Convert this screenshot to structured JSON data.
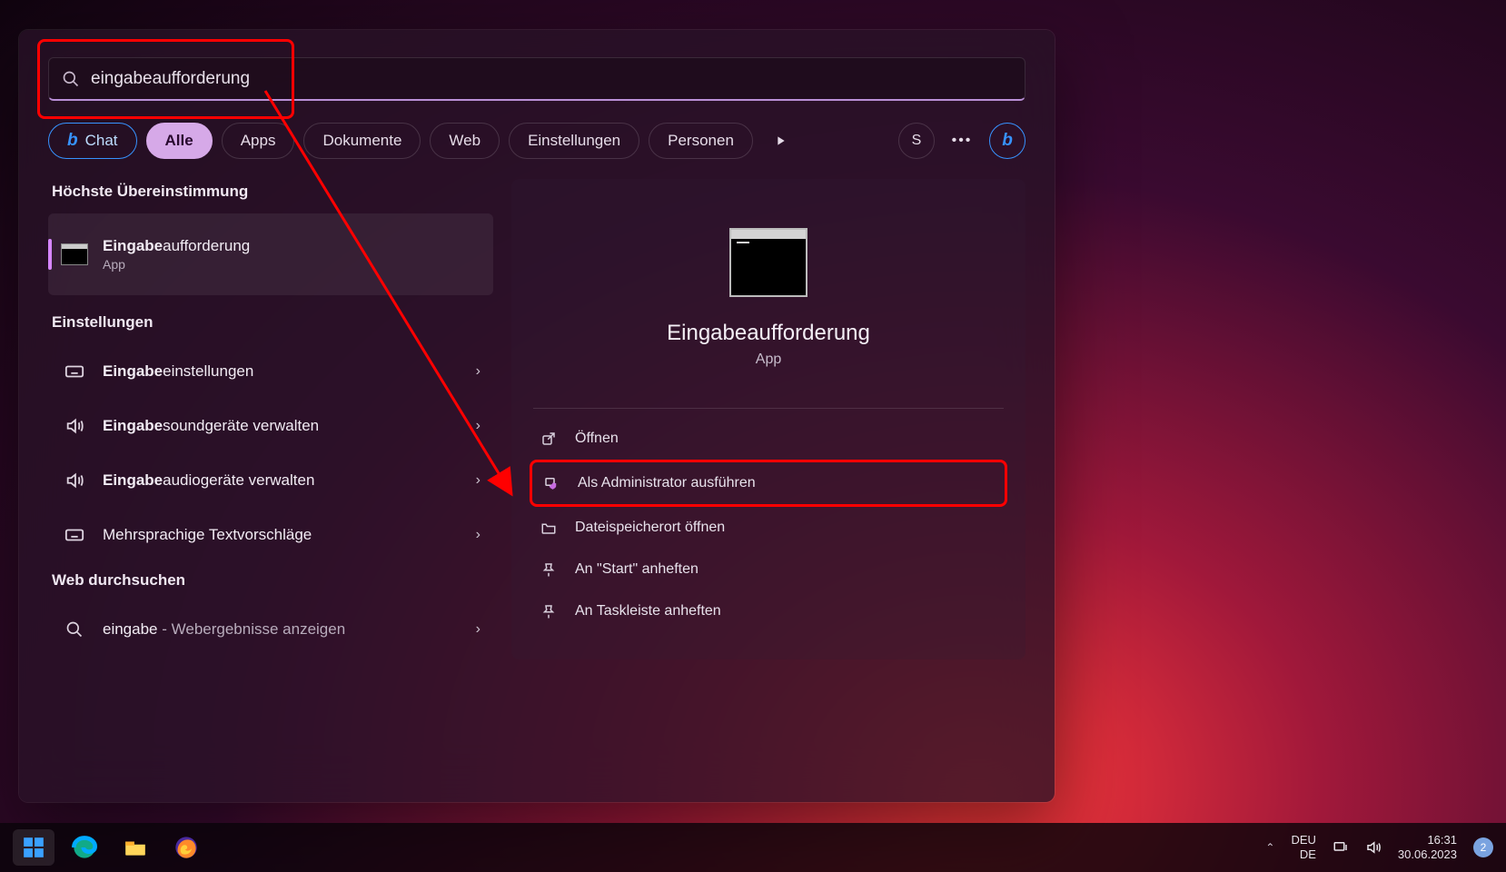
{
  "search": {
    "prefix": "eingabe",
    "suffix": "aufforderung"
  },
  "filters": {
    "chat": "Chat",
    "all": "Alle",
    "apps": "Apps",
    "documents": "Dokumente",
    "web": "Web",
    "settings": "Einstellungen",
    "people": "Personen",
    "avatar_initial": "S"
  },
  "left": {
    "best_match_header": "Höchste Übereinstimmung",
    "best": {
      "bold": "Eingabe",
      "rest": "aufforderung",
      "sub": "App"
    },
    "settings_header": "Einstellungen",
    "settings_items": [
      {
        "bold": "Eingabe",
        "rest": "einstellungen",
        "icon": "keyboard"
      },
      {
        "bold": "Eingabe",
        "rest": "soundgeräte verwalten",
        "icon": "sound"
      },
      {
        "bold": "Eingabe",
        "rest": "audiogeräte verwalten",
        "icon": "sound"
      },
      {
        "bold": "",
        "rest": "Mehrsprachige Textvorschläge",
        "icon": "keyboard"
      }
    ],
    "web_header": "Web durchsuchen",
    "web_item": {
      "query": "eingabe",
      "suffix": " - Webergebnisse anzeigen"
    }
  },
  "right": {
    "title": "Eingabeaufforderung",
    "sub": "App",
    "actions": {
      "open": "Öffnen",
      "admin": "Als Administrator ausführen",
      "location": "Dateispeicherort öffnen",
      "pin_start": "An \"Start\" anheften",
      "pin_taskbar": "An Taskleiste anheften"
    }
  },
  "taskbar": {
    "lang_top": "DEU",
    "lang_bottom": "DE",
    "time": "16:31",
    "date": "30.06.2023",
    "notifications": "2"
  }
}
